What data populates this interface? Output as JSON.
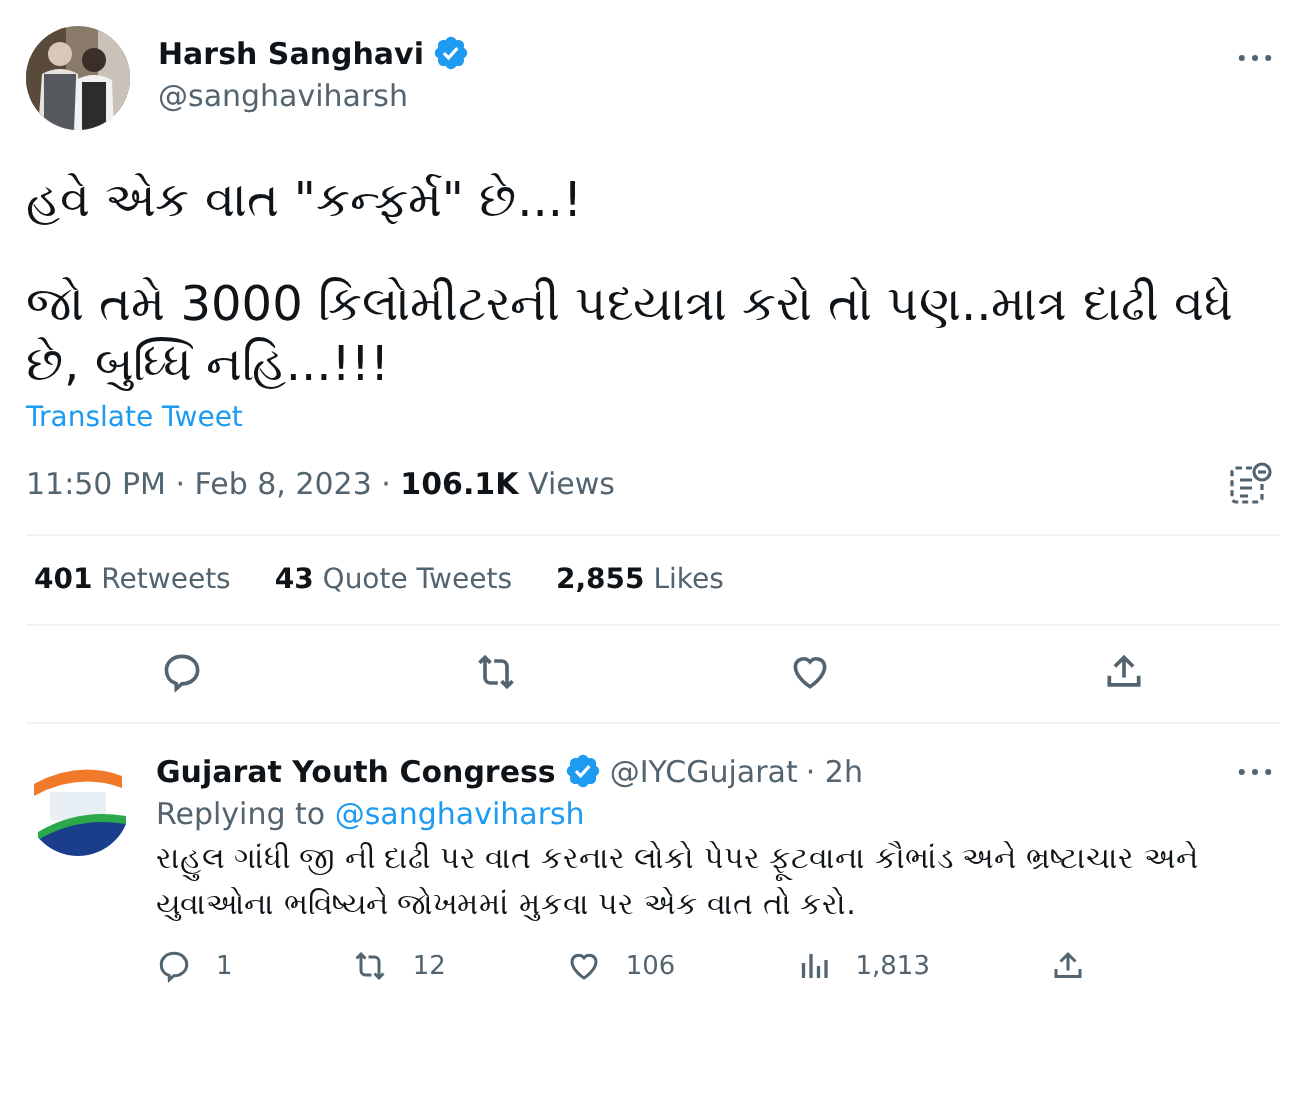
{
  "tweet": {
    "author": {
      "name": "Harsh Sanghavi",
      "handle": "@sanghaviharsh",
      "verified": true
    },
    "paragraphs": [
      "હવે એક વાત \"કન્ફર્મ\" છે...!",
      "જો તમે 3000 કિલોમીટરની પદયાત્રા કરો તો પણ..માત્ર દાઢી વધે છે, બુધ્ધિ નહિ...!!!"
    ],
    "translate": "Translate Tweet",
    "time": "11:50 PM · Feb 8, 2023 · ",
    "views_count": "106.1K",
    "views_label": " Views",
    "stats": [
      {
        "count": "401",
        "label": "Retweets"
      },
      {
        "count": "43",
        "label": "Quote Tweets"
      },
      {
        "count": "2,855",
        "label": "Likes"
      }
    ]
  },
  "reply": {
    "author": {
      "name": "Gujarat Youth Congress",
      "handle": "@IYCGujarat",
      "time": "· 2h",
      "verified": true
    },
    "replying_prefix": "Replying to ",
    "replying_handle": "@sanghaviharsh",
    "text": "રાહુલ ગાંધી જી ની  દાઢી પર વાત કરનાર લોકો પેપર ફૂટવાના કૌભાંડ અને ભ્રષ્ટાચાર અને યુવાઓના ભવિષ્યને જોખમમાં મુકવા પર એક વાત તો કરો.",
    "actions": [
      {
        "kind": "reply",
        "count": "1"
      },
      {
        "kind": "retweet",
        "count": "12"
      },
      {
        "kind": "like",
        "count": "106"
      },
      {
        "kind": "views",
        "count": "1,813"
      },
      {
        "kind": "share"
      }
    ]
  }
}
